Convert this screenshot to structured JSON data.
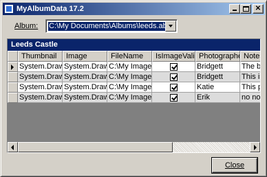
{
  "window": {
    "title": "MyAlbumData 17.2",
    "icon": "app-icon",
    "controls": [
      "minimize",
      "maximize",
      "close"
    ]
  },
  "album": {
    "label": "Album:",
    "value": "C:\\My Documents\\Albums\\leeds.abm"
  },
  "grid": {
    "caption": "Leeds Castle",
    "columns": [
      "Thumbnail",
      "Image",
      "FileName",
      "IsImageValid",
      "Photographer",
      "Notes"
    ],
    "rows": [
      {
        "thumbnail": "System.Drawi",
        "image": "System.Drawi",
        "filename": "C:\\My Images",
        "valid": true,
        "photographer": "Bridgett",
        "notes": "The b"
      },
      {
        "thumbnail": "System.Drawi",
        "image": "System.Drawi",
        "filename": "C:\\My Images",
        "valid": true,
        "photographer": "Bridgett",
        "notes": "This is"
      },
      {
        "thumbnail": "System.Drawi",
        "image": "System.Drawi",
        "filename": "C:\\My Images",
        "valid": true,
        "photographer": "Katie",
        "notes": "This p"
      },
      {
        "thumbnail": "System.Drawi",
        "image": "System.Drawi",
        "filename": "C:\\My Images",
        "valid": true,
        "photographer": "Erik",
        "notes": "no no"
      }
    ],
    "current_row": 0
  },
  "buttons": {
    "close_label": "Close"
  },
  "colors": {
    "titlebar_start": "#0a246a",
    "titlebar_end": "#a6caf0",
    "face": "#d4d0c8",
    "grid_background": "#808080",
    "caption": "#0a246a"
  }
}
